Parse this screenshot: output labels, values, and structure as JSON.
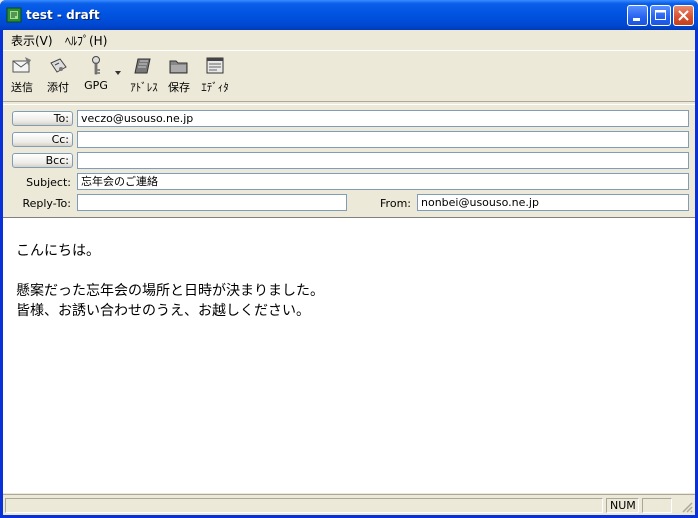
{
  "window": {
    "title": "test - draft"
  },
  "menu": [
    {
      "label": "表示(V)"
    },
    {
      "label": "ﾍﾙﾌﾟ(H)"
    }
  ],
  "toolbar": [
    {
      "label": "送信",
      "icon": "send-icon"
    },
    {
      "label": "添付",
      "icon": "attach-icon"
    },
    {
      "label": "GPG",
      "icon": "key-icon"
    },
    {
      "label": "ｱﾄﾞﾚｽ",
      "icon": "address-book-icon"
    },
    {
      "label": "保存",
      "icon": "folder-icon"
    },
    {
      "label": "ｴﾃﾞｨﾀ",
      "icon": "editor-icon"
    }
  ],
  "fields": {
    "to_label": "To:",
    "to_value": "veczo@usouso.ne.jp",
    "cc_label": "Cc:",
    "cc_value": "",
    "bcc_label": "Bcc:",
    "bcc_value": "",
    "subject_label": "Subject:",
    "subject_value": "忘年会のご連絡",
    "replyto_label": "Reply-To:",
    "replyto_value": "",
    "from_label": "From:",
    "from_value": "nonbei@usouso.ne.jp"
  },
  "body": {
    "lines": [
      "こんにちは。",
      "",
      "懸案だった忘年会の場所と日時が決まりました。",
      "皆様、お誘い合わせのうえ、お越しください。"
    ]
  },
  "status": {
    "num": "NUM"
  }
}
